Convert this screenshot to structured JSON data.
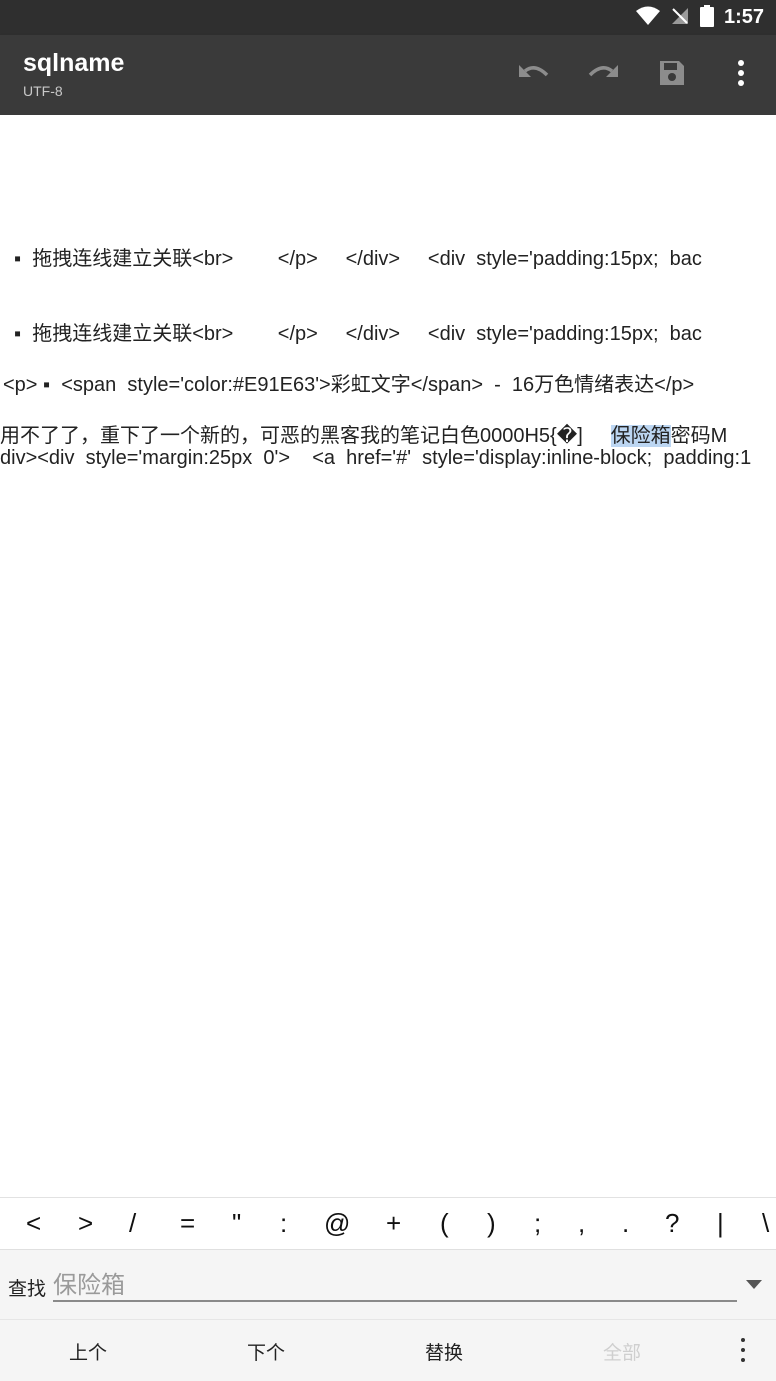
{
  "status": {
    "time": "1:57"
  },
  "toolbar": {
    "title": "sqlname",
    "subtitle": "UTF-8",
    "icons": [
      "undo-icon",
      "redo-icon",
      "save-icon",
      "more-vert-icon"
    ]
  },
  "editor": {
    "lines": [
      "▪  拖拽连线建立关联<br>        </p>     </div>     <div  style='padding:15px;  bac",
      "▪  拖拽连线建立关联<br>        </p>     </div>     <div  style='padding:15px;  bac",
      "<p> ▪  <span  style='color:#E91E63'>彩虹文字</span>  -  16万色情绪表达</p>",
      "用不了了，重下了一个新的，可恶的黑客我的笔记白色0000H5{�]     ",
      "保险箱",
      "密码M",
      "div><div  style='margin:25px  0'>    <a  href='#'  style='display:inline-block;  padding:1"
    ]
  },
  "symbols": [
    "<",
    ">",
    "/",
    "=",
    "\"",
    ":",
    "@",
    "+",
    "(",
    ")",
    ";",
    ",",
    ".",
    "?",
    "|",
    "\\"
  ],
  "find": {
    "label": "查找",
    "value": "保险箱"
  },
  "actions": {
    "prev": "上个",
    "next": "下个",
    "replace": "替换",
    "all": "全部"
  }
}
